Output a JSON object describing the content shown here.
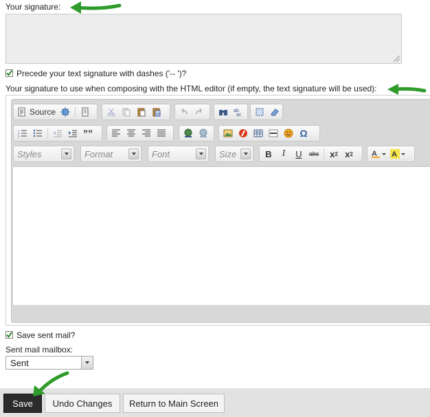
{
  "signature": {
    "label": "Your signature:",
    "value": ""
  },
  "precede_dashes": {
    "label": "Precede your text signature with dashes ('-- ')?",
    "checked": true
  },
  "html_signature": {
    "label": "Your signature to use when composing with the HTML editor (if empty, the text signature will be used):"
  },
  "editor": {
    "toolbar": {
      "source_label": "Source",
      "combos": {
        "styles": "Styles",
        "format": "Format",
        "font": "Font",
        "size": "Size"
      },
      "buttons": {
        "bold": "B",
        "italic": "I",
        "underline": "U",
        "strike": "abc",
        "subscript_base": "x",
        "subscript_idx": "2",
        "superscript_base": "x",
        "superscript_idx": "2",
        "quote": "””",
        "omega": "Ω"
      }
    },
    "content": ""
  },
  "save_sent": {
    "label": "Save sent mail?",
    "checked": true
  },
  "sent_mailbox": {
    "label": "Sent mail mailbox:",
    "selected": "Sent"
  },
  "buttons": {
    "save": "Save",
    "undo": "Undo Changes",
    "return": "Return to Main Screen"
  },
  "colors": {
    "arrow": "#2e9b2b",
    "save_bg": "#2b2b2b",
    "bar_bg": "#e2e2e2"
  }
}
